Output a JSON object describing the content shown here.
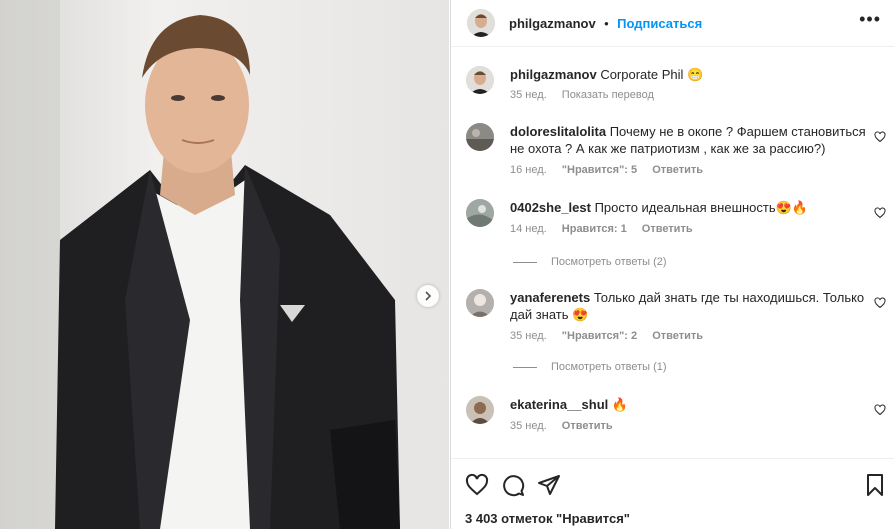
{
  "post": {
    "author": "philgazmanov",
    "separator": "•",
    "follow_label": "Подписаться",
    "more_label": "•••",
    "caption_author": "philgazmanov",
    "caption_text": "Corporate Phil 😁",
    "caption_time": "35 нед.",
    "translate_label": "Показать перевод",
    "likes": "3 403 отметок \"Нравится\""
  },
  "comments": [
    {
      "user": "doloreslitalolita",
      "text": "Почему не в окопе ? Фаршем становиться не охота ? А как же патриотизм , как же за рассию?)",
      "time": "16 нед.",
      "likes": "\"Нравится\": 5",
      "reply": "Ответить"
    },
    {
      "user": "0402she_lest",
      "text": "Просто идеальная внешность😍🔥",
      "time": "14 нед.",
      "likes": "Нравится: 1",
      "reply": "Ответить",
      "view_replies": "Посмотреть ответы (2)"
    },
    {
      "user": "yanaferenets",
      "text": "Только дай знать где ты находишься. Только дай знать 😍",
      "time": "35 нед.",
      "likes": "\"Нравится\": 2",
      "reply": "Ответить",
      "view_replies": "Посмотреть ответы (1)"
    },
    {
      "user": "ekaterina__shul",
      "text": "🔥",
      "time": "35 нед.",
      "reply": "Ответить"
    }
  ],
  "colors": {
    "accent": "#0095f6",
    "text": "#262626",
    "muted": "#8e8e8e",
    "jacket": "#1f1f22"
  },
  "icons": [
    "heart-icon",
    "comment-icon",
    "share-icon",
    "bookmark-icon",
    "chevron-right-icon",
    "more-icon"
  ]
}
